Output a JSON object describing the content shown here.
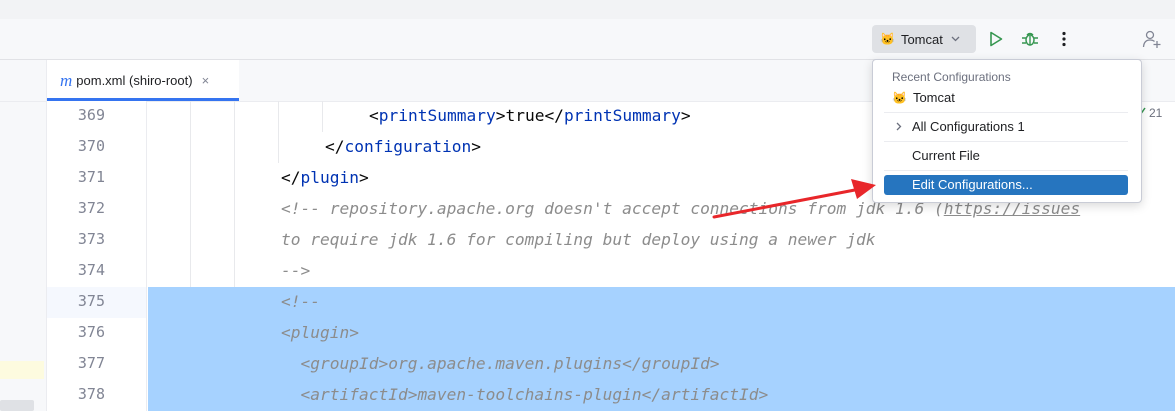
{
  "toolbar": {
    "run_config_label": "Tomcat",
    "icons": [
      "tomcat-cat-icon",
      "chevron-down-icon",
      "run-icon",
      "debug-icon",
      "more-icon",
      "add-user-icon"
    ]
  },
  "tab": {
    "icon_letter": "m",
    "label": "pom.xml (shiro-root)",
    "close": "×"
  },
  "popup": {
    "header": "Recent Configurations",
    "recent_item": "Tomcat",
    "all_configurations": "All Configurations 1",
    "current_file": "Current File",
    "edit_configurations": "Edit Configurations..."
  },
  "inspection": {
    "count": "21"
  },
  "editor": {
    "line_numbers": [
      "369",
      "370",
      "371",
      "372",
      "373",
      "374",
      "375",
      "376",
      "377",
      "378"
    ],
    "lines": {
      "l369": {
        "open_lt": "<",
        "open_tag": "printSummary",
        "open_gt": ">",
        "text": "true",
        "close_lt": "</",
        "close_tag": "printSummary",
        "close_gt": ">"
      },
      "l370": {
        "lt": "</",
        "tag": "configuration",
        "gt": ">"
      },
      "l371": {
        "lt": "</",
        "tag": "plugin",
        "gt": ">"
      },
      "l372": {
        "comment": "<!-- repository.apache.org doesn't accept connections from jdk 1.6 (",
        "url": "https://issues"
      },
      "l373": {
        "comment": "to require jdk 1.6 for compiling but deploy using a newer jdk"
      },
      "l374": {
        "comment": "-->"
      },
      "l375": {
        "comment": "<!--"
      },
      "l376": {
        "comment": "<plugin>"
      },
      "l377": {
        "comment": "  <groupId>org.apache.maven.plugins</groupId>"
      },
      "l378": {
        "comment": "  <artifactId>maven-toolchains-plugin</artifactId>"
      }
    }
  },
  "colors": {
    "accent": "#3574f0",
    "selection": "#a6d2ff",
    "popup_highlight": "#2675bf",
    "xml_tag": "#0033b3",
    "comment": "#8c8c8c",
    "run_green": "#369650",
    "annotation_arrow": "#e8262a"
  }
}
